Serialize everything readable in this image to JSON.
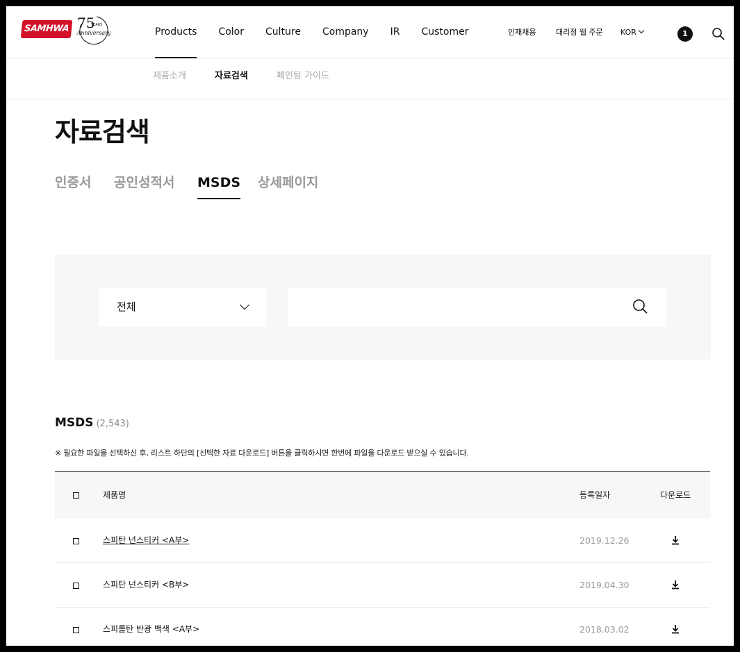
{
  "header": {
    "logo_text": "SAMHWA",
    "anniversary": {
      "number": "75",
      "years": "YEARS",
      "label": "Anniversary"
    },
    "nav": [
      {
        "label": "Products",
        "active": true
      },
      {
        "label": "Color",
        "active": false
      },
      {
        "label": "Culture",
        "active": false
      },
      {
        "label": "Company",
        "active": false
      },
      {
        "label": "IR",
        "active": false
      },
      {
        "label": "Customer",
        "active": false
      }
    ],
    "utility": {
      "careers": "인재채용",
      "dealer_order": "대리점 웹 주문",
      "language": "KOR"
    },
    "badge_count": "1",
    "search_icon": "search-icon"
  },
  "subnav": [
    {
      "label": "제품소개",
      "active": false
    },
    {
      "label": "자료검색",
      "active": true
    },
    {
      "label": "페인팅 가이드",
      "active": false
    }
  ],
  "page_title": "자료검색",
  "tabs": [
    {
      "label": "인증서",
      "active": false
    },
    {
      "label": "공인성적서",
      "active": false
    },
    {
      "label": "MSDS",
      "active": true
    },
    {
      "label": "상세페이지",
      "active": false
    }
  ],
  "search": {
    "select_value": "전체",
    "input_value": "",
    "placeholder": ""
  },
  "results": {
    "title": "MSDS",
    "count": "(2,543)",
    "notice": "※ 필요한 파일을 선택하신 후, 리스트 하단의 [선택한 자료 다운로드] 버튼을 클릭하시면 한번에 파일을 다운로드 받으실 수 있습니다.",
    "columns": {
      "name": "제품명",
      "date": "등록일자",
      "download": "다운로드"
    },
    "rows": [
      {
        "name": "스피탄 넌스티커 <A부>",
        "date": "2019.12.26",
        "underlined": true
      },
      {
        "name": "스피탄 넌스티커 <B부>",
        "date": "2019.04.30",
        "underlined": false
      },
      {
        "name": "스피롤탄 반광 백색 <A부>",
        "date": "2018.03.02",
        "underlined": false
      }
    ]
  },
  "colors": {
    "brand_red": "#d3122a",
    "text": "#111111",
    "muted": "#999999",
    "panel": "#f7f7f7"
  }
}
